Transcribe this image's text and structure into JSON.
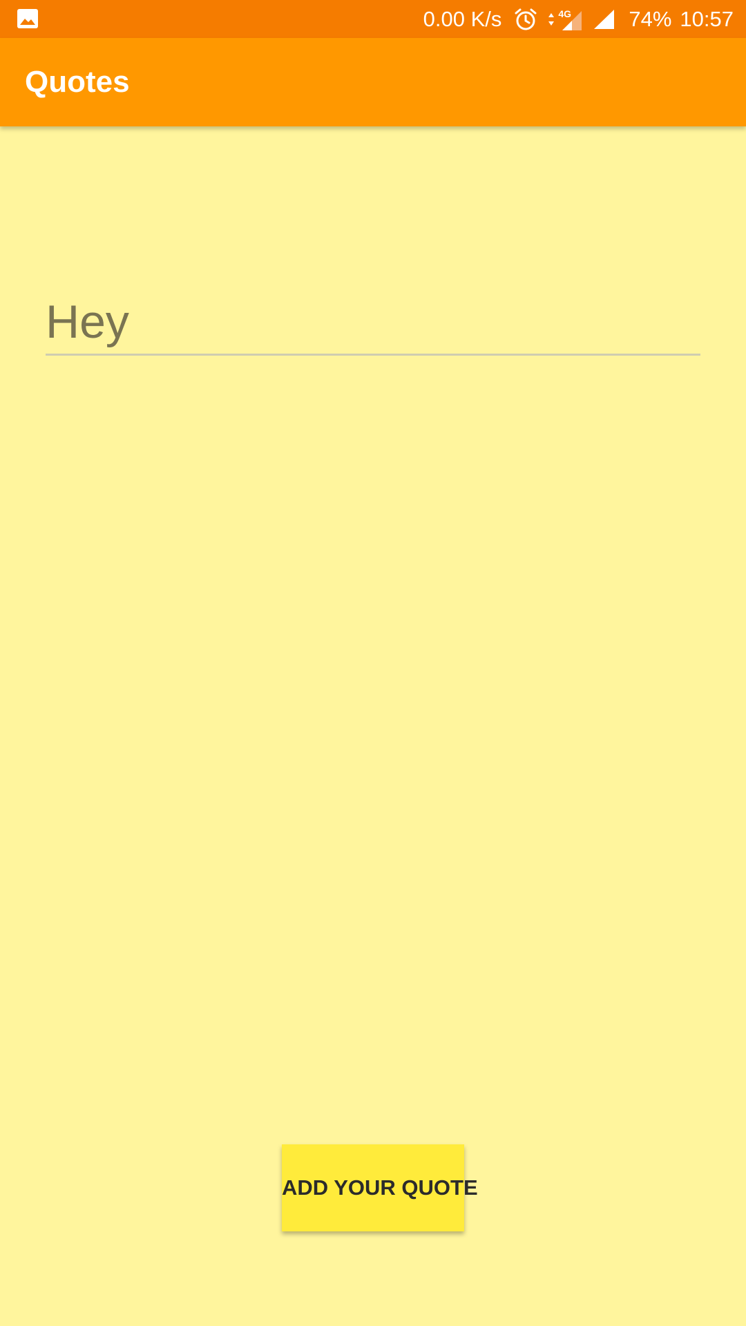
{
  "status_bar": {
    "notification_icon": "image-icon",
    "net_speed": "0.00 K/s",
    "alarm_icon": "alarm-clock-icon",
    "network_type": "4G",
    "battery": "74%",
    "time": "10:57"
  },
  "app_bar": {
    "title": "Quotes"
  },
  "quote_input": {
    "value": "Hey",
    "placeholder": ""
  },
  "actions": {
    "add_quote_label": "ADD YOUR QUOTE"
  },
  "colors": {
    "status_bar": "#F57C00",
    "app_bar": "#FF9800",
    "background": "#FFF59D",
    "button": "#FFEB3B"
  }
}
